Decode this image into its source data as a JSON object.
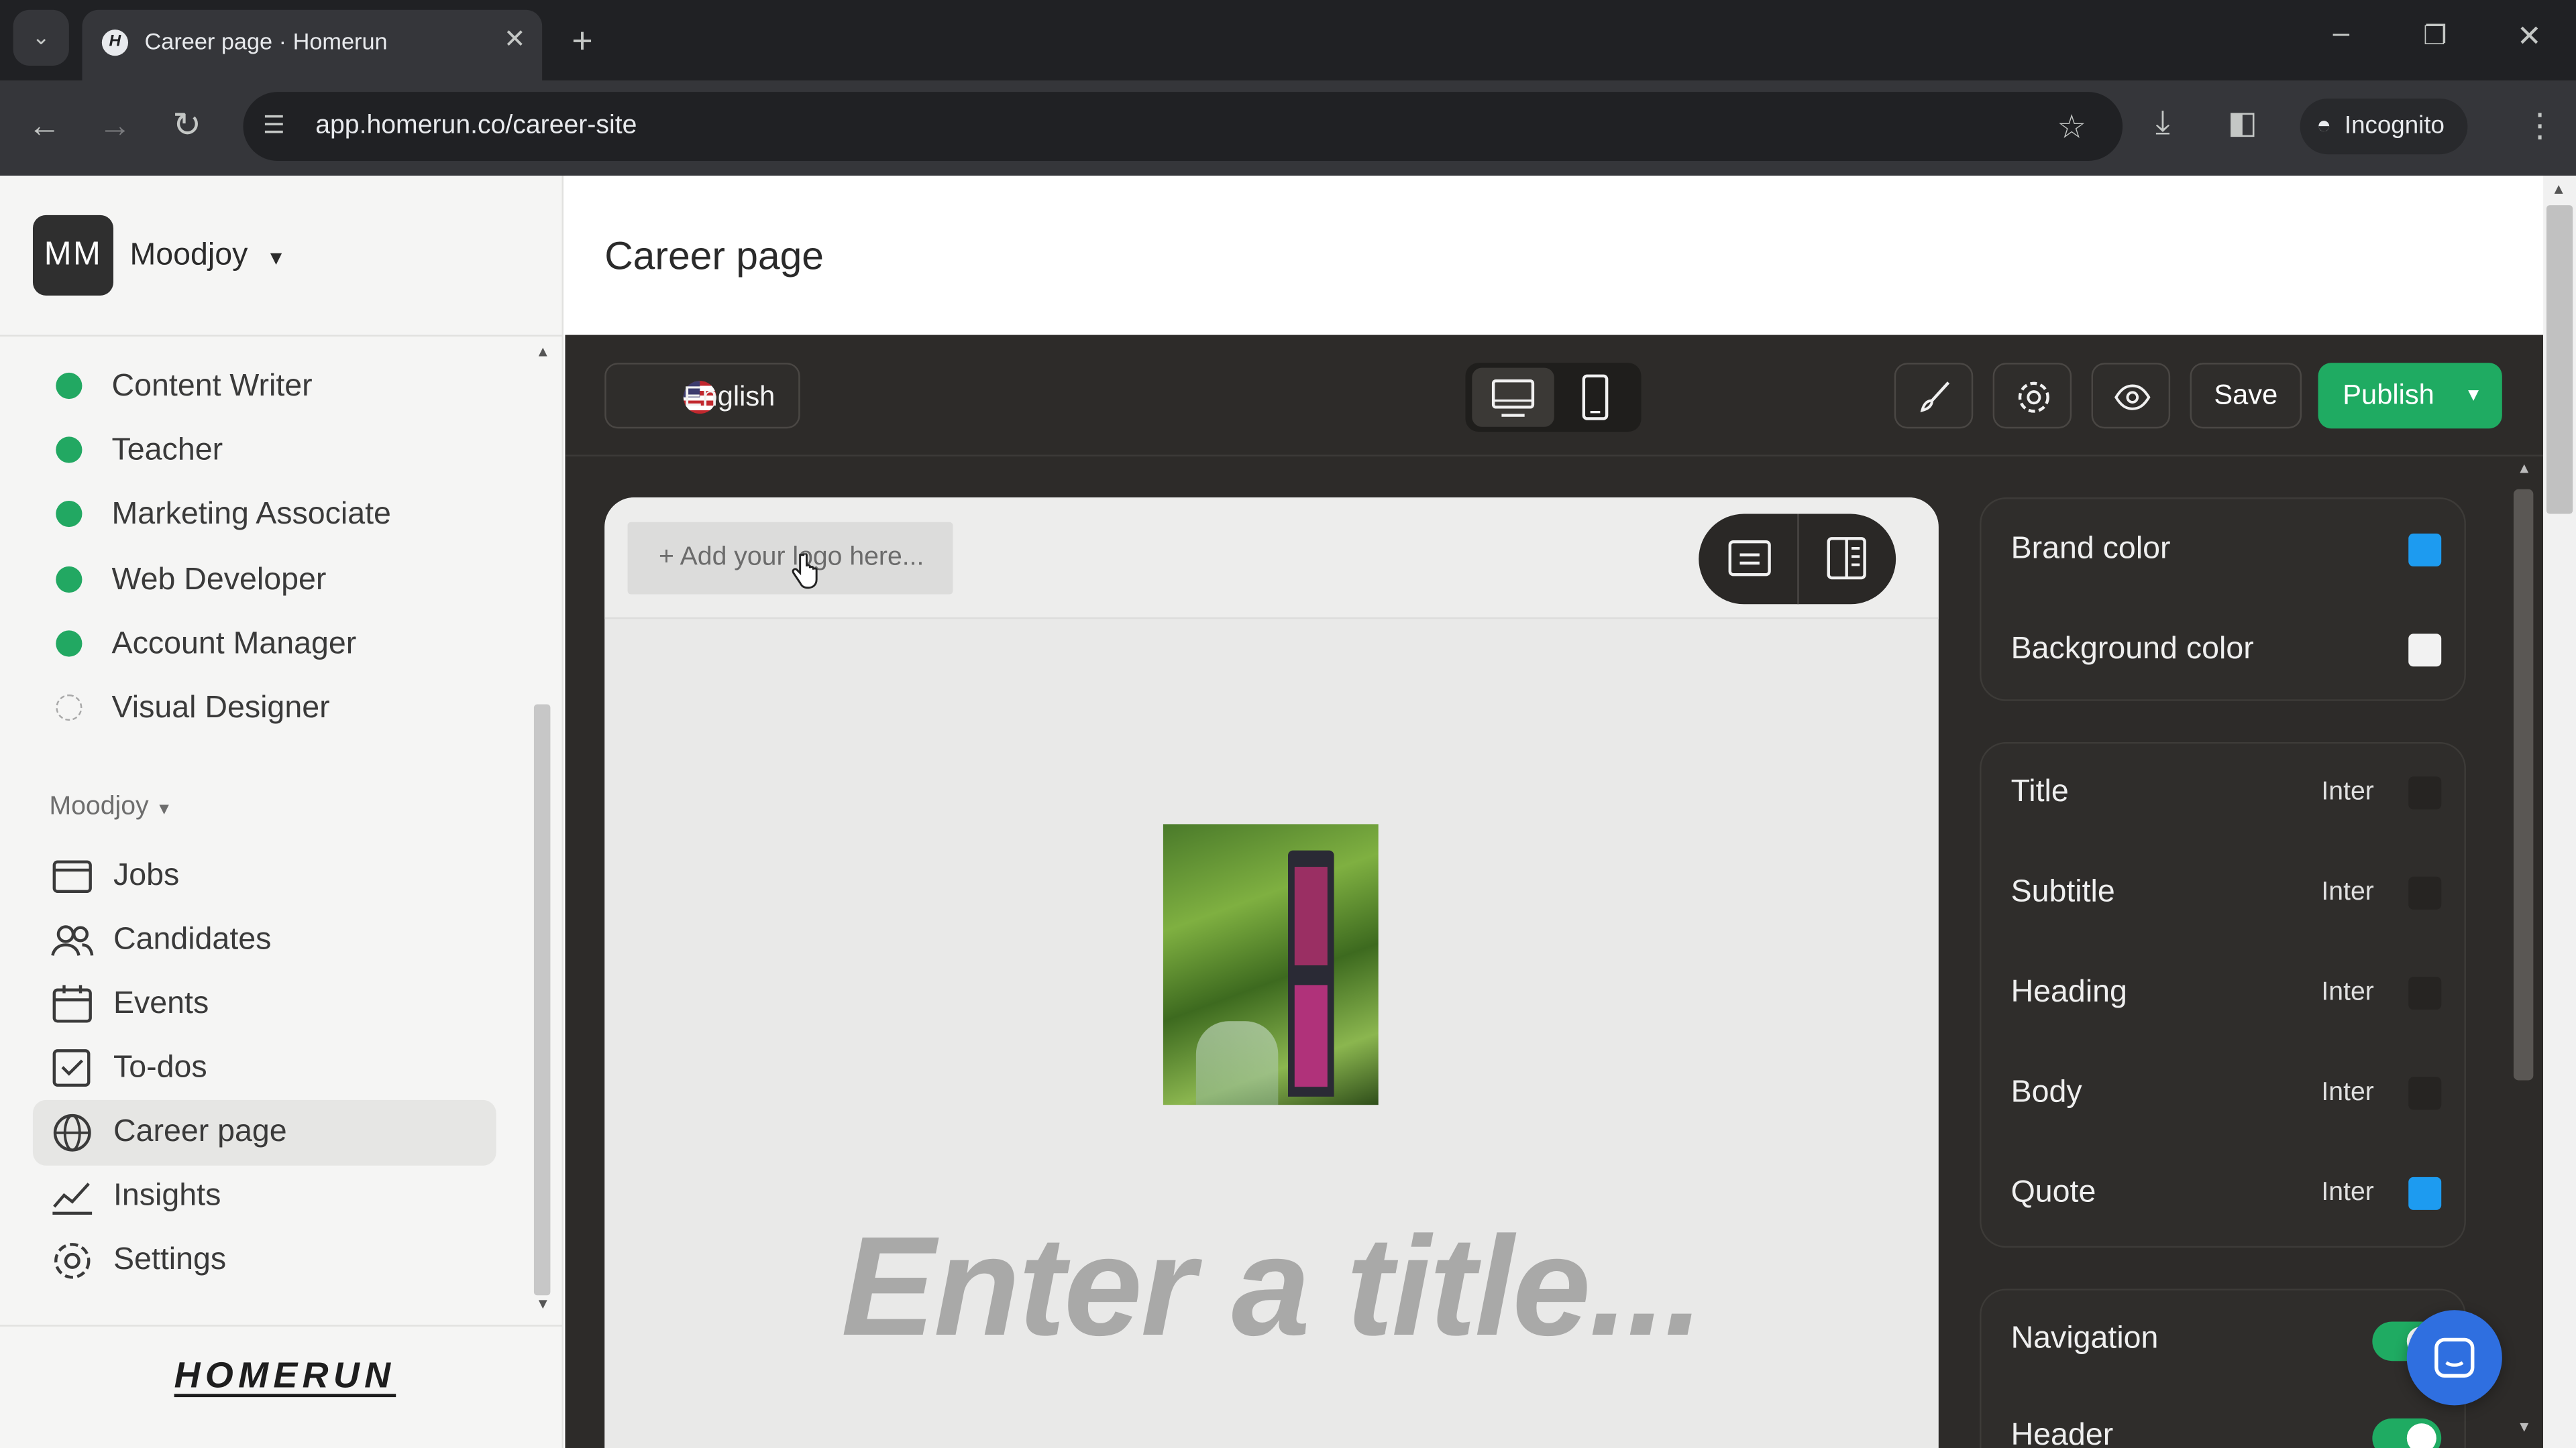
{
  "browser": {
    "tab_title": "Career page · Homerun",
    "tab_favicon": "H",
    "url": "app.homerun.co/career-site",
    "incognito_label": "Incognito"
  },
  "sidebar": {
    "org_initials": "MM",
    "org_name": "Moodjoy",
    "jobs": [
      {
        "label": "Content Writer",
        "status": "published"
      },
      {
        "label": "Teacher",
        "status": "published"
      },
      {
        "label": "Marketing Associate",
        "status": "published"
      },
      {
        "label": "Web Developer",
        "status": "published"
      },
      {
        "label": "Account Manager",
        "status": "published"
      },
      {
        "label": "Visual Designer",
        "status": "draft"
      }
    ],
    "section_label": "Moodjoy",
    "nav": [
      {
        "label": "Jobs",
        "icon": "jobs-icon"
      },
      {
        "label": "Candidates",
        "icon": "candidates-icon"
      },
      {
        "label": "Events",
        "icon": "calendar-icon"
      },
      {
        "label": "To-dos",
        "icon": "checkbox-icon"
      },
      {
        "label": "Career page",
        "icon": "globe-icon",
        "active": true
      },
      {
        "label": "Insights",
        "icon": "chart-icon"
      },
      {
        "label": "Settings",
        "icon": "gear-icon"
      }
    ],
    "brand": "HOMERUN"
  },
  "main": {
    "page_title": "Career page",
    "language": "English",
    "save_label": "Save",
    "publish_label": "Publish",
    "logo_placeholder": "+ Add your logo here...",
    "title_placeholder": "Enter a title...",
    "colors": {
      "brand": "#1d9bf0",
      "background": "#f2f2f2",
      "accent": "#1fab62"
    }
  },
  "panel": {
    "color_settings": [
      {
        "label": "Brand color",
        "swatch": "#1d9bf0"
      },
      {
        "label": "Background color",
        "swatch": "#f2f2f2"
      }
    ],
    "typography": [
      {
        "label": "Title",
        "font": "Inter",
        "swatch": "#262422"
      },
      {
        "label": "Subtitle",
        "font": "Inter",
        "swatch": "#262422"
      },
      {
        "label": "Heading",
        "font": "Inter",
        "swatch": "#262422"
      },
      {
        "label": "Body",
        "font": "Inter",
        "swatch": "#262422"
      },
      {
        "label": "Quote",
        "font": "Inter",
        "swatch": "#1d9bf0"
      }
    ],
    "toggles": [
      {
        "label": "Navigation",
        "on": true
      },
      {
        "label": "Header",
        "on": true
      }
    ]
  }
}
